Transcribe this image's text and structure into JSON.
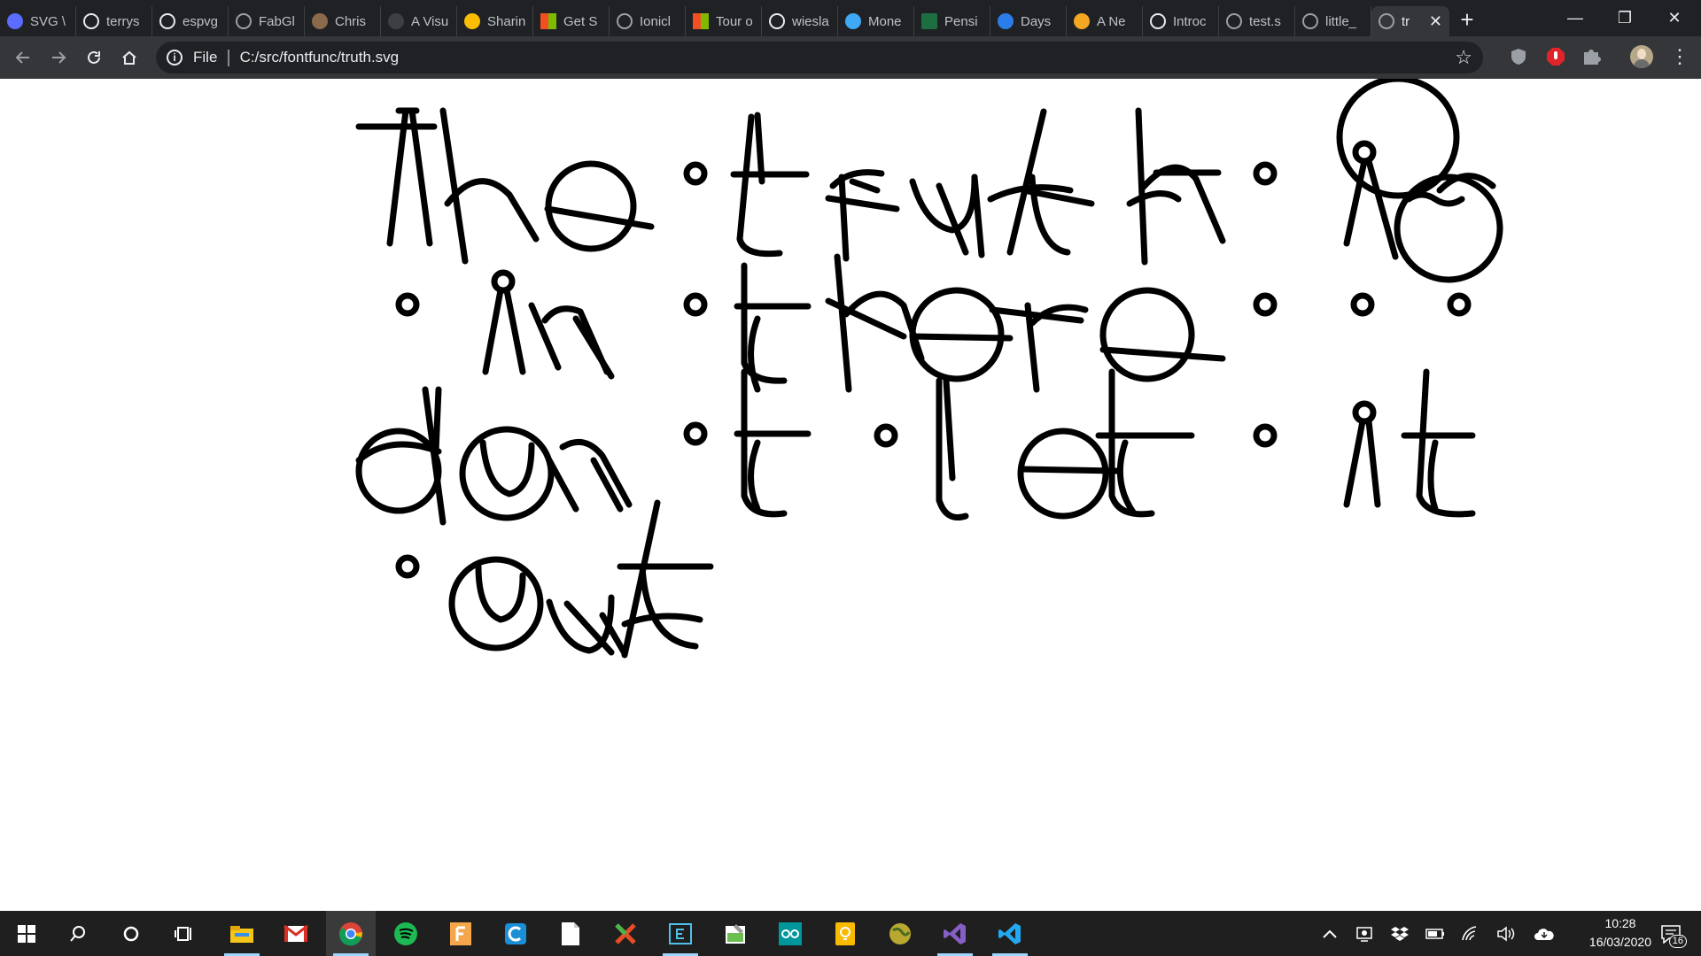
{
  "browser": {
    "tabs": [
      {
        "label": "SVG \\",
        "icon": "svg-icon",
        "color": "#5b6cff"
      },
      {
        "label": "terrys",
        "icon": "github-icon",
        "color": "#e8eaed"
      },
      {
        "label": "espvg",
        "icon": "github-icon",
        "color": "#e8eaed"
      },
      {
        "label": "FabGl",
        "icon": "globe-icon",
        "color": "#9aa0a6"
      },
      {
        "label": "Chris",
        "icon": "photo-icon",
        "color": "#8a6a4a"
      },
      {
        "label": "A Visu",
        "icon": "circle-icon",
        "color": "#3c4043"
      },
      {
        "label": "Sharin",
        "icon": "pinwheel-icon",
        "color": "#fbbc04"
      },
      {
        "label": "Get S",
        "icon": "windows-logo-icon",
        "color": "#f25022"
      },
      {
        "label": "Ionicl",
        "icon": "globe-icon",
        "color": "#9aa0a6"
      },
      {
        "label": "Tour o",
        "icon": "windows-logo-icon",
        "color": "#f25022"
      },
      {
        "label": "wiesla",
        "icon": "github-icon",
        "color": "#e8eaed"
      },
      {
        "label": "Mone",
        "icon": "edge-icon",
        "color": "#3fa9f5"
      },
      {
        "label": "Pensi",
        "icon": "excel-icon",
        "color": "#1d6f42"
      },
      {
        "label": "Days",
        "icon": "diamond-icon",
        "color": "#2b7de9"
      },
      {
        "label": "A Ne",
        "icon": "sun-icon",
        "color": "#f5a623"
      },
      {
        "label": "Introc",
        "icon": "graduation-cap-icon",
        "color": "#e8eaed"
      },
      {
        "label": "test.s",
        "icon": "globe-icon",
        "color": "#9aa0a6"
      },
      {
        "label": "little_",
        "icon": "globe-icon",
        "color": "#9aa0a6"
      }
    ],
    "active_tab": {
      "label": "tr",
      "icon": "globe-icon",
      "close": "✕"
    },
    "new_tab": "+",
    "window_controls": {
      "minimize": "—",
      "maximize": "❐",
      "close": "✕"
    },
    "address": {
      "scheme": "File",
      "separator": "|",
      "url": "C:/src/fontfunc/truth.svg"
    },
    "colors": {
      "frame": "#202124",
      "toolbar": "#35363a",
      "omnibox": "#202124",
      "text": "#e8eaed"
    }
  },
  "document": {
    "lines": [
      "The truth is",
      "in there",
      "don't let it",
      "out"
    ],
    "glyph_color": "#000000"
  },
  "taskbar": {
    "apps": [
      "start-icon",
      "search-icon",
      "cortana-icon",
      "task-view-icon",
      "file-explorer-icon",
      "gmail-icon",
      "chrome-icon",
      "spotify-icon",
      "fusion-icon",
      "ccleaner-icon",
      "notepad-icon",
      "xming-icon",
      "editor-icon",
      "paint-icon",
      "arduino-icon",
      "bulb-icon",
      "globe-app-icon",
      "visual-studio-icon",
      "vscode-icon"
    ],
    "tray": [
      "chevron-up-icon",
      "security-tray-icon",
      "dropbox-icon",
      "battery-icon",
      "wifi-icon",
      "volume-icon",
      "onedrive-icon"
    ],
    "time": "10:28",
    "date": "16/03/2020",
    "notifications": "16"
  }
}
